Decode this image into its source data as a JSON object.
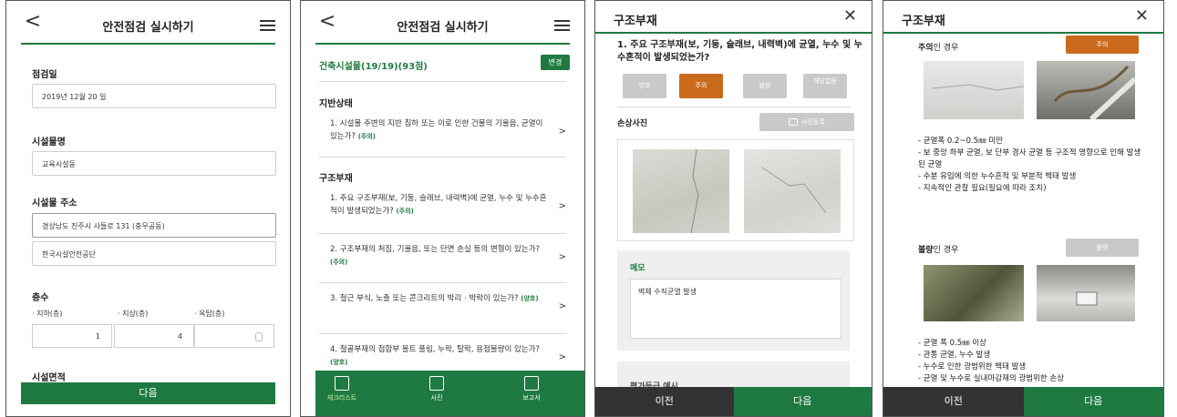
{
  "screen1": {
    "back_glyph": "<",
    "title": "안전점검 실시하기",
    "menu_icon": "hamburger-icon",
    "inspection_date_label": "점검일",
    "inspection_date_value": "2019년 12월 20 일",
    "facility_name_label": "시설물명",
    "facility_name_value": "교육시설동",
    "address_label": "시설물 주소",
    "address_value": "경상남도 진주시 사들로 131 (충무공동)",
    "address_detail_value": "한국시설안전공단",
    "floors_label": "층수",
    "basement_label": "· 지하(층)",
    "ground_label": "· 지상(층)",
    "rooftop_label": "· 옥탑(층)",
    "basement_value": "1",
    "ground_value": "4",
    "area_label": "시설면적",
    "next_button": "다음"
  },
  "screen2": {
    "back_glyph": "<",
    "title": "안전점검 실시하기",
    "summary": "건축시설물(19/19)(93점)",
    "change_button": "변경",
    "section1": "지반상태",
    "section2": "구조부재",
    "chevron": ">",
    "questions": [
      {
        "text": "1. 시설물 주변의 지반 침하 또는 이로 인한 건물의 기울음, 균열이 있는가?",
        "status": "(주의)"
      },
      {
        "text": "1. 주요 구조부재(보, 기둥, 슬래브, 내력벽)에 균열, 누수 및 누수흔적이 발생되었는가?",
        "status": "(주의)"
      },
      {
        "text": "2. 구조부재의 처짐, 기울음, 또는 단면 손실 등의 변형이 있는가?",
        "status": "(주의)"
      },
      {
        "text": "3. 철근 부식, 노출 또는 콘크리트의 박리 · 박락이 있는가?",
        "status": "(양호)"
      },
      {
        "text": "4. 철골부재의 접합부 볼트 풀림, 누락, 탈락, 용접불량이 있는가?",
        "status": "(양호)"
      }
    ],
    "tabs": [
      {
        "label": "체크리스트",
        "icon": "checklist-icon"
      },
      {
        "label": "사진",
        "icon": "photo-icon"
      },
      {
        "label": "보고서",
        "icon": "report-icon"
      }
    ]
  },
  "screen3": {
    "title": "구조부재",
    "close_glyph": "✕",
    "question": "1. 주요 구조부재(보, 기둥, 슬래브, 내력벽)에 균열, 누수 및 누수흔적이 발생되었는가?",
    "options": [
      "양호",
      "주의",
      "불량",
      "해당없음"
    ],
    "selected_option": "주의",
    "photo_label": "손상사진",
    "photo_register_button": "사진등록",
    "memo_label": "메모",
    "memo_value": "벽체 수직균열 발생",
    "eval_label": "평가등급 예시",
    "prev_button": "이전",
    "next_button": "다음"
  },
  "screen4": {
    "title": "구조부재",
    "close_glyph": "✕",
    "caution_case_bold": "주의",
    "caution_case_suffix": "인 경우",
    "caution_button": "주의",
    "caution_desc": [
      "- 균열폭 0.2~0.5㎜ 미만",
      "- 보 중앙 하부 균열, 보 단부 경사 균열 등 구조적 영향으로 인해 발생된 균열",
      "- 수분 유입에 의한 누수흔적 및 부분적 백태 발생",
      "- 지속적인 관찰 필요(필요에 따라 조치)"
    ],
    "bad_case_bold": "불량",
    "bad_case_suffix": "인 경우",
    "bad_button": "불량",
    "bad_desc": [
      "- 균열 폭 0.5㎜ 이상",
      "- 관통 균열, 누수 발생",
      "- 누수로 인한 광범위한 백태 발생",
      "- 균열 및 누수로 실내마감재의 광범위한 손상"
    ],
    "prev_button": "이전",
    "next_button": "다음"
  },
  "colors": {
    "brand_green": "#1f7a41",
    "caution_orange": "#c96a1c",
    "inactive_gray": "#c9c9c9",
    "dark_bar": "#333333"
  }
}
